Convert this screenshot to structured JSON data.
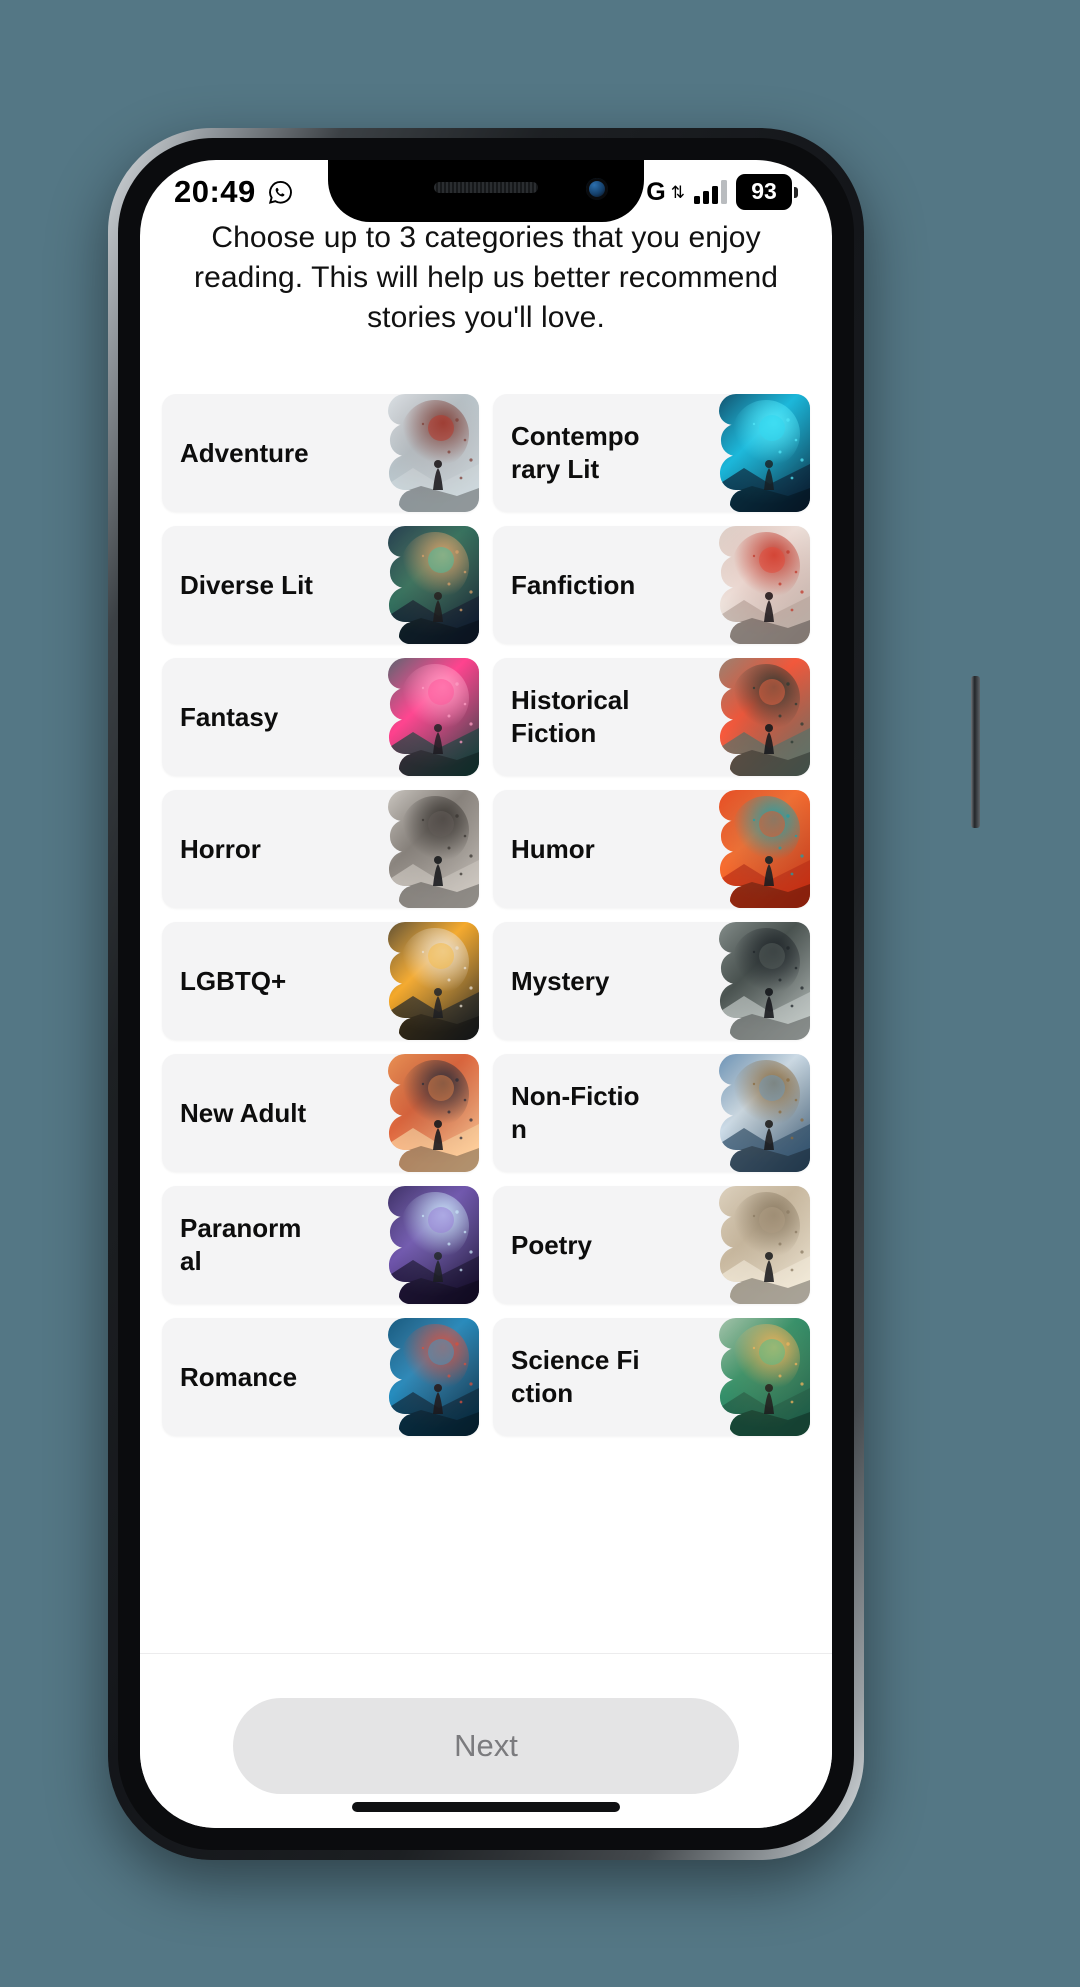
{
  "status_bar": {
    "time": "20:49",
    "whatsapp_icon": "whatsapp-icon",
    "network_label": "G",
    "data_arrows": "⇅",
    "signal_icon": "signal-bars-icon",
    "battery_percent": "93"
  },
  "screen": {
    "subtitle": "Choose up to 3 categories that you enjoy reading. This will help us better recommend stories you'll love.",
    "max_selectable": 3,
    "selected_count": 0
  },
  "categories": [
    {
      "label": "Adventure",
      "art": "hiker-snow-mountain",
      "c1": "#e9eef2",
      "c2": "#b9c7cd",
      "c3": "#7f4038",
      "c4": "#cfd9de",
      "accent": "#c0392b"
    },
    {
      "label": "Contemporary Lit",
      "art": "figure-blue-sparks",
      "c1": "#0d2b45",
      "c2": "#18b4d8",
      "c3": "#52e6f7",
      "c4": "#0a1f33",
      "accent": "#2bd6ef"
    },
    {
      "label": "Diverse Lit",
      "art": "cosmic-dreamer",
      "c1": "#1c2a4a",
      "c2": "#2e6f5e",
      "c3": "#d9a06a",
      "c4": "#0f1a2e",
      "accent": "#36c3a6"
    },
    {
      "label": "Fanfiction",
      "art": "red-boat-clouds",
      "c1": "#d8ccc4",
      "c2": "#efe7e1",
      "c3": "#c0392b",
      "c4": "#b9aaa2",
      "accent": "#e74c3c"
    },
    {
      "label": "Fantasy",
      "art": "glowing-mushroom",
      "c1": "#1f6f63",
      "c2": "#ff3d8b",
      "c3": "#ff9ec4",
      "c4": "#13403a",
      "accent": "#ff4d96"
    },
    {
      "label": "Historical Fiction",
      "art": "samurai-red-moon",
      "c1": "#7d9185",
      "c2": "#ff5a3c",
      "c3": "#2b3a33",
      "c4": "#5d7268",
      "accent": "#ff6a45"
    },
    {
      "label": "Horror",
      "art": "shadow-figures",
      "c1": "#e4e0da",
      "c2": "#8e8882",
      "c3": "#3a3632",
      "c4": "#cfc9c2",
      "accent": "#6b6560"
    },
    {
      "label": "Humor",
      "art": "red-swirl-figure",
      "c1": "#e8401c",
      "c2": "#ff6b2b",
      "c3": "#1fa0a8",
      "c4": "#c22d12",
      "accent": "#ff4d1a"
    },
    {
      "label": "LGBTQ+",
      "art": "confetti-street",
      "c1": "#2a2f33",
      "c2": "#f5a623",
      "c3": "#e8dfd2",
      "c4": "#1a1e21",
      "accent": "#f7b733"
    },
    {
      "label": "Mystery",
      "art": "detective-alley",
      "c1": "#9aa3a0",
      "c2": "#4d5653",
      "c3": "#20262a",
      "c4": "#c3cac7",
      "accent": "#5c6663"
    },
    {
      "label": "New Adult",
      "art": "couple-sunset-city",
      "c1": "#f2a15c",
      "c2": "#e4683d",
      "c3": "#2b2e3a",
      "c4": "#ffd3a0",
      "accent": "#f08a4b"
    },
    {
      "label": "Non-Fiction",
      "art": "landscape-clouds-river",
      "c1": "#4a7ba8",
      "c2": "#cfe0ee",
      "c3": "#8a6b3f",
      "c4": "#2f4f6b",
      "accent": "#6b9fc9"
    },
    {
      "label": "Paranormal",
      "art": "lone-tree-starfield",
      "c1": "#2a1f4a",
      "c2": "#6b4fa8",
      "c3": "#c9e4f7",
      "c4": "#170f2e",
      "accent": "#8f6fd1"
    },
    {
      "label": "Poetry",
      "art": "pier-birds-dusk",
      "c1": "#e6dccb",
      "c2": "#cbbba2",
      "c3": "#8a7a62",
      "c4": "#f2ead9",
      "accent": "#b4a288"
    },
    {
      "label": "Romance",
      "art": "two-figures-blue-city",
      "c1": "#0f4a6b",
      "c2": "#1f8fc4",
      "c3": "#d94f3d",
      "c4": "#08293d",
      "accent": "#2aa3d4"
    },
    {
      "label": "Science Fiction",
      "art": "comet-green-horizon",
      "c1": "#c9d6c4",
      "c2": "#2e8f6b",
      "c3": "#f2b35c",
      "c4": "#1f5c47",
      "accent": "#3fbf8f"
    }
  ],
  "footer": {
    "next_label": "Next",
    "next_enabled": false
  }
}
